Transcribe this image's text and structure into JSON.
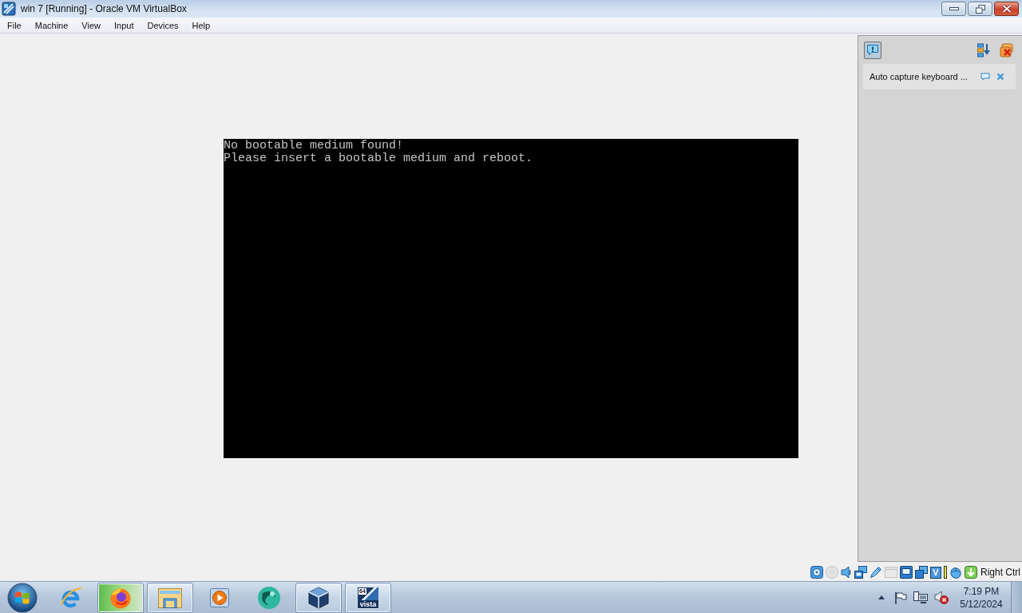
{
  "window": {
    "title": "win 7 [Running] - Oracle VM VirtualBox"
  },
  "menu": [
    {
      "label": "File"
    },
    {
      "label": "Machine"
    },
    {
      "label": "View"
    },
    {
      "label": "Input"
    },
    {
      "label": "Devices"
    },
    {
      "label": "Help"
    }
  ],
  "vm_screen": {
    "lines": [
      "No bootable medium found!",
      "Please insert a bootable medium and reboot."
    ]
  },
  "notification_center": {
    "messages": [
      {
        "text": "Auto capture keyboard ..."
      }
    ]
  },
  "status_bar": {
    "indicators": [
      {
        "kind": "hard-disk",
        "enabled": true
      },
      {
        "kind": "optical",
        "enabled": false
      },
      {
        "kind": "audio",
        "enabled": true
      },
      {
        "kind": "network",
        "enabled": true
      },
      {
        "kind": "usb",
        "enabled": true
      },
      {
        "kind": "shared-folders",
        "enabled": false
      },
      {
        "kind": "display",
        "enabled": true
      },
      {
        "kind": "recording",
        "enabled": true
      },
      {
        "kind": "virtualization",
        "enabled": true,
        "label": "V"
      },
      {
        "kind": "activity",
        "enabled": true
      },
      {
        "kind": "mouse",
        "enabled": true
      },
      {
        "kind": "keyboard",
        "enabled": true
      }
    ],
    "host_key": "Right Ctrl"
  },
  "taskbar": {
    "apps": [
      {
        "kind": "ie",
        "running": false,
        "hovered": false
      },
      {
        "kind": "firefox",
        "running": true,
        "hovered": true
      },
      {
        "kind": "folder",
        "running": true,
        "hovered": false
      },
      {
        "kind": "media",
        "running": false,
        "hovered": false
      },
      {
        "kind": "sphere",
        "running": false,
        "hovered": false
      },
      {
        "kind": "cube",
        "running": true,
        "hovered": false
      },
      {
        "kind": "vista",
        "running": true,
        "hovered": false,
        "badge": "64",
        "caption": "vista"
      }
    ],
    "clock": {
      "time": "7:19 PM",
      "date": "5/12/2024"
    }
  }
}
